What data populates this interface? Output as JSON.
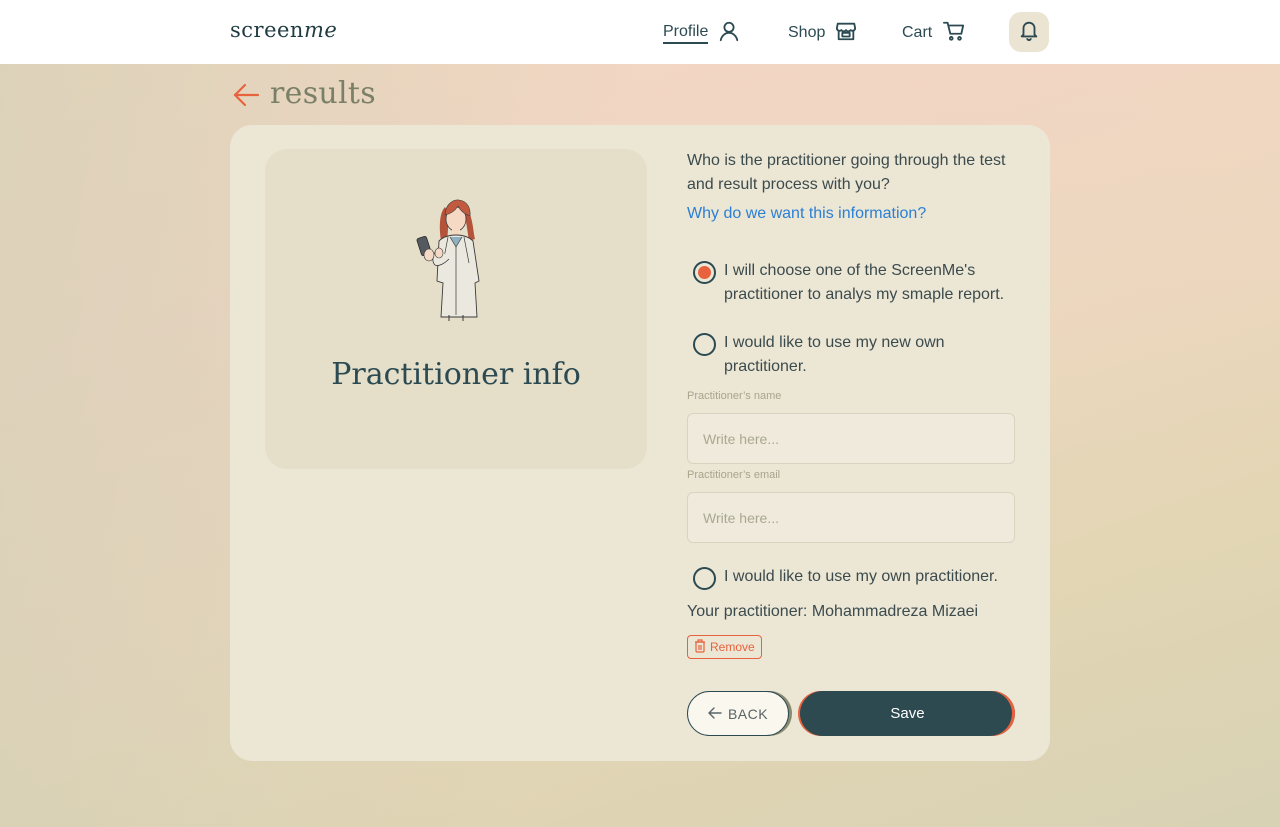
{
  "header": {
    "logo_part1": "screen",
    "logo_part2": "me",
    "nav": {
      "profile": "Profile",
      "shop": "Shop",
      "cart": "Cart"
    },
    "icons": [
      "user-icon",
      "store-icon",
      "cart-icon",
      "bell-icon"
    ]
  },
  "page": {
    "title": "results"
  },
  "info_panel": {
    "title": "Practitioner info"
  },
  "form": {
    "question": "Who is the practitioner going through the test and result process with you?",
    "why_link": "Why do we want this information?",
    "options": [
      {
        "label": "I will choose one of the ScreenMe's practitioner to analys my smaple report.",
        "checked": true
      },
      {
        "label": "I would like to use my new own practitioner.",
        "checked": false
      },
      {
        "label": "I would like to use my own practitioner.",
        "checked": false
      }
    ],
    "name_label": "Practitioner’s name",
    "name_placeholder": "Write here...",
    "email_label": "Practitioner’s email",
    "email_placeholder": "Write here...",
    "your_practitioner": "Your practitioner: Mohammadreza Mizaei",
    "remove_label": "Remove",
    "back_label": "BACK",
    "save_label": "Save"
  },
  "colors": {
    "primary": "#2d4a51",
    "accent": "#e8623e",
    "link": "#2b7fd4",
    "card": "#ece6d5"
  }
}
